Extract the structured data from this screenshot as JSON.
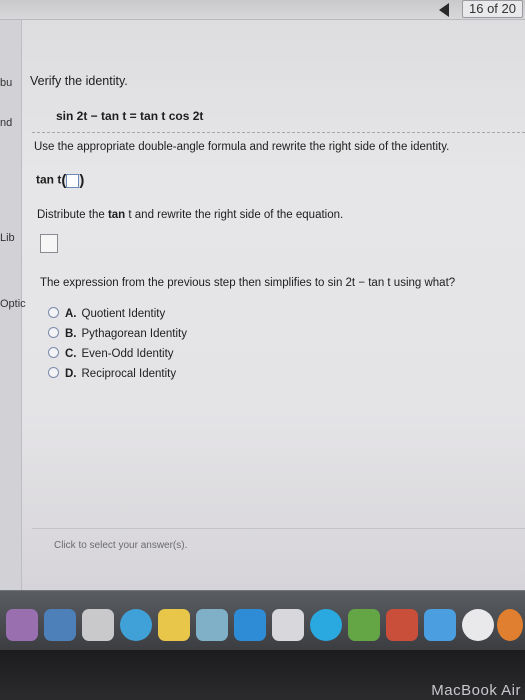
{
  "header": {
    "counter": "16 of 20"
  },
  "sidebar_fragments": [
    "bu",
    "nd",
    "Lib",
    "Optic"
  ],
  "problem": {
    "prompt": "Verify the identity.",
    "identity": "sin 2t − tan t = tan t cos 2t"
  },
  "step1": {
    "instruction": "Use the appropriate double-angle formula and rewrite the right side of the identity.",
    "prefix": "tan t"
  },
  "step2": {
    "instruction_a": "Distribute the ",
    "instruction_bold": "tan",
    "instruction_b": " t and rewrite the right side of the equation."
  },
  "step3": {
    "question": "The expression from the previous step then simplifies to sin 2t − tan t using what?"
  },
  "options": [
    {
      "letter": "A.",
      "label": "Quotient Identity"
    },
    {
      "letter": "B.",
      "label": "Pythagorean Identity"
    },
    {
      "letter": "C.",
      "label": "Even-Odd Identity"
    },
    {
      "letter": "D.",
      "label": "Reciprocal Identity"
    }
  ],
  "footer": {
    "hint": "Click to select your answer(s)."
  },
  "device": {
    "brand": "MacBook Air"
  }
}
